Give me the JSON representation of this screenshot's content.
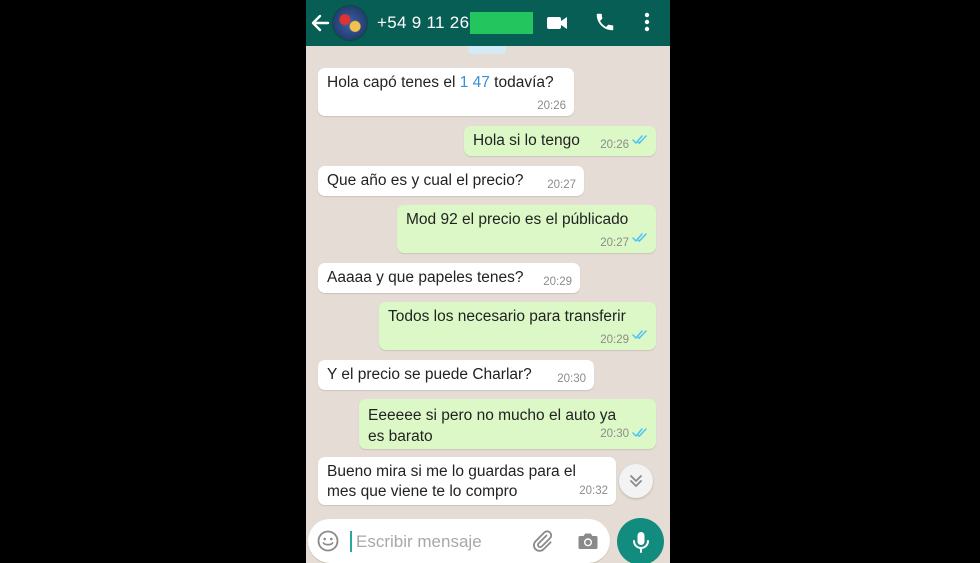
{
  "header": {
    "contact_number": "+54 9 11 26",
    "icons": [
      "back-arrow-icon",
      "avatar",
      "video-call-icon",
      "phone-icon",
      "more-vert-icon"
    ]
  },
  "messages": [
    {
      "dir": "in",
      "parts": [
        "Hola capó tenes el ",
        "1 47",
        " todavía?"
      ],
      "time": "20:26"
    },
    {
      "dir": "out",
      "text": "Hola si lo tengo",
      "time": "20:26",
      "status": "read"
    },
    {
      "dir": "in",
      "text": "Que año es  y cual el precio?",
      "time": "20:27"
    },
    {
      "dir": "out",
      "text": "Mod 92 el precio es el públicado",
      "time": "20:27",
      "status": "read"
    },
    {
      "dir": "in",
      "text": "Aaaaa y que papeles tenes?",
      "time": "20:29"
    },
    {
      "dir": "out",
      "text": "Todos los necesario para transferir",
      "time": "20:29",
      "status": "read"
    },
    {
      "dir": "in",
      "text": "Y el precio se puede  Charlar?",
      "time": "20:30"
    },
    {
      "dir": "out",
      "lines": [
        "Eeeeee si pero no mucho el auto ya",
        "es barato"
      ],
      "time": "20:30",
      "status": "read"
    },
    {
      "dir": "in",
      "lines": [
        "Bueno mira si me lo guardas  para el",
        "mes que viene  te lo compro"
      ],
      "time": "20:32"
    }
  ],
  "composer": {
    "placeholder": "Escribir mensaje"
  },
  "colors": {
    "header": "#075e54",
    "chat_bg": "#e5ddd5",
    "outgoing_bubble": "#dcf8c6",
    "incoming_bubble": "#ffffff",
    "read_ticks": "#4fc3f7",
    "link": "#3a8fd8",
    "mic_button": "#128c7e",
    "redaction": "#22c55e"
  }
}
